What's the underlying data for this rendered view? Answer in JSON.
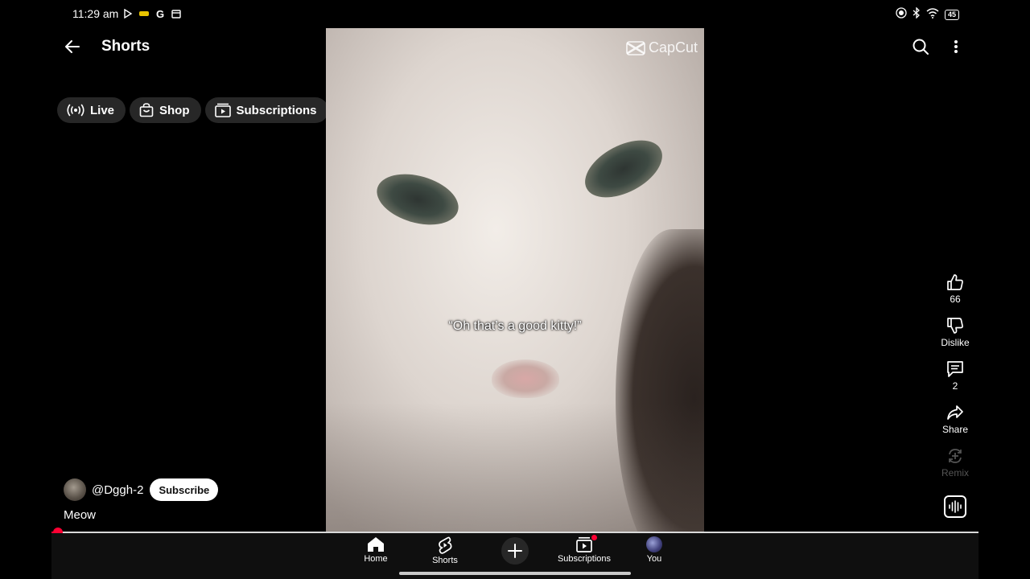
{
  "status_bar": {
    "time": "11:29 am",
    "battery": "45",
    "notification_icons": [
      "play-store-icon",
      "app-icon",
      "google-icon",
      "calendar-icon"
    ],
    "system_icons": [
      "record-icon",
      "bluetooth-icon",
      "wifi-icon",
      "battery-icon"
    ]
  },
  "header": {
    "title": "Shorts"
  },
  "chips": [
    {
      "label": "Live",
      "icon": "live-icon"
    },
    {
      "label": "Shop",
      "icon": "shop-icon"
    },
    {
      "label": "Subscriptions",
      "icon": "subscriptions-icon"
    }
  ],
  "video": {
    "watermark": "CapCut",
    "caption": "“Oh that’s a good kitty!”"
  },
  "actions": {
    "like_count": "66",
    "dislike_label": "Dislike",
    "comment_count": "2",
    "share_label": "Share",
    "remix_label": "Remix"
  },
  "channel": {
    "handle": "@Dggh-2",
    "subscribe_label": "Subscribe"
  },
  "video_title": "Meow",
  "playback": {
    "progress_fraction": 0.007
  },
  "bottom_nav": {
    "home": "Home",
    "shorts": "Shorts",
    "subscriptions": "Subscriptions",
    "you": "You"
  },
  "colors": {
    "background": "#000000",
    "accent": "#ff0033",
    "chip_bg": "#272727",
    "nav_bg": "#0f0f0f"
  }
}
